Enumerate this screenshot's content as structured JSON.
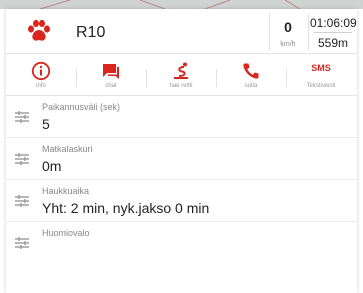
{
  "header": {
    "device_name": "R10",
    "speed": "0",
    "speed_unit": "km/h",
    "time": "01:06:09",
    "distance": "559m"
  },
  "actions": [
    {
      "label": "info",
      "icon": "info-icon"
    },
    {
      "label": "chat",
      "icon": "chat-icon"
    },
    {
      "label": "hae reitti",
      "icon": "route-icon"
    },
    {
      "label": "soita",
      "icon": "phone-icon"
    },
    {
      "label": "Tekstiviesti",
      "icon_text": "SMS"
    }
  ],
  "settings": [
    {
      "label": "Paikannusväli (sek)",
      "value": "5"
    },
    {
      "label": "Matkalaskuri",
      "value": "0m"
    },
    {
      "label": "Haukkuaika",
      "value": "Yht: 2 min, nyk.jakso 0 min"
    },
    {
      "label": "Huomiovalo",
      "value": ""
    }
  ],
  "colors": {
    "accent_red": "#d9251d",
    "label_grey": "#888888"
  }
}
